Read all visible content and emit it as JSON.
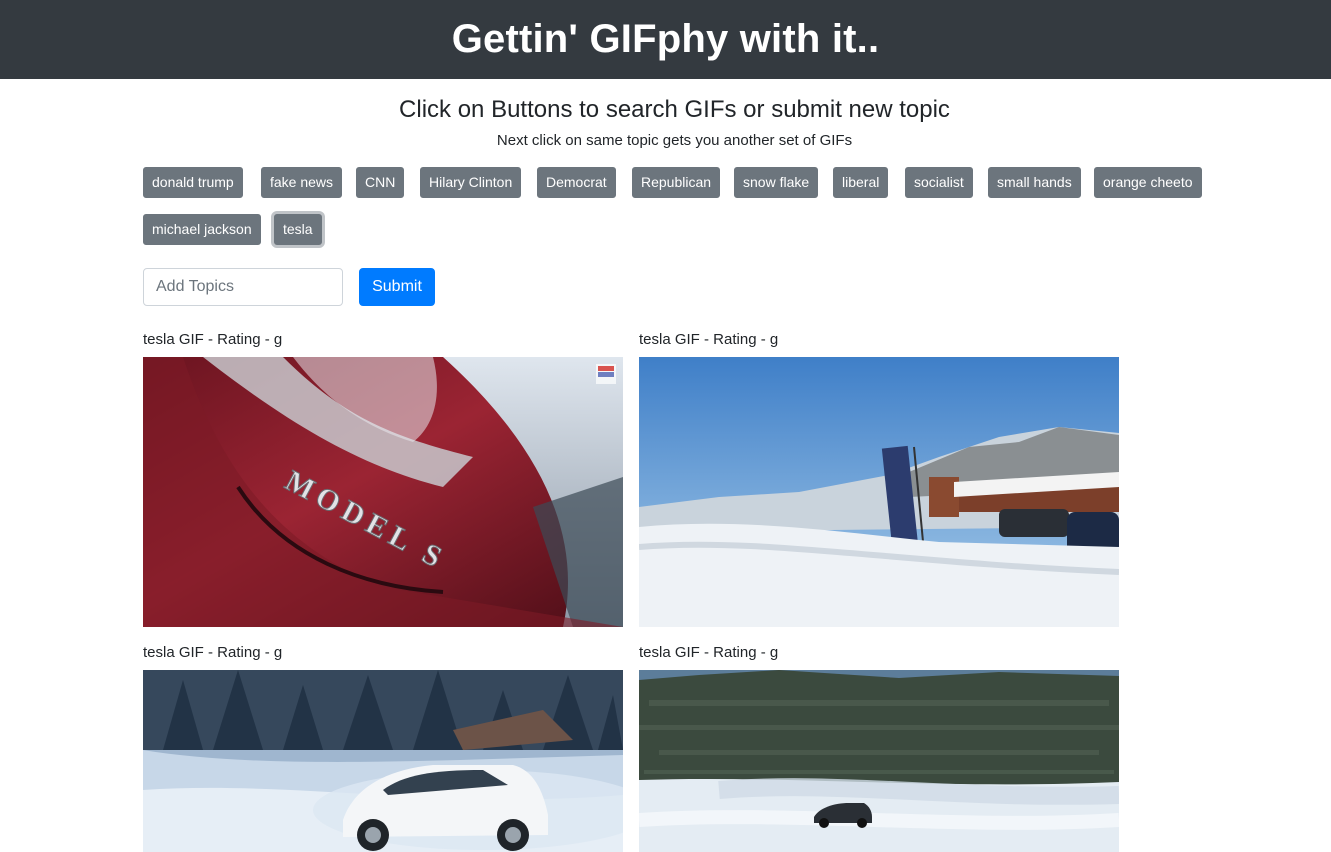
{
  "header": {
    "title": "Gettin' GIFphy with it.."
  },
  "intro": {
    "heading": "Click on Buttons to search GIFs or submit new topic",
    "subheading": "Next click on same topic gets you another set of GIFs"
  },
  "topics": [
    "donald trump",
    "fake news",
    "CNN",
    "Hilary Clinton",
    "Democrat",
    "Republican",
    "snow flake",
    "liberal",
    "socialist",
    "small hands",
    "orange cheeto",
    "michael jackson",
    "tesla"
  ],
  "active_topic": "tesla",
  "form": {
    "placeholder": "Add Topics",
    "value": "",
    "submit_label": "Submit"
  },
  "gifs": [
    {
      "caption": "tesla GIF - Rating - g",
      "scene": "red Model S close-up with MODEL S badge"
    },
    {
      "caption": "tesla GIF - Rating - g",
      "scene": "snowy track with flag banner and cars"
    },
    {
      "caption": "tesla GIF - Rating - g",
      "scene": "white Tesla drifting in snowy forest"
    },
    {
      "caption": "tesla GIF - Rating - g",
      "scene": "car drifting on frozen lake with forest"
    }
  ],
  "colors": {
    "banner": "#343a40",
    "topic_button": "#6c757d",
    "primary": "#007bff"
  }
}
